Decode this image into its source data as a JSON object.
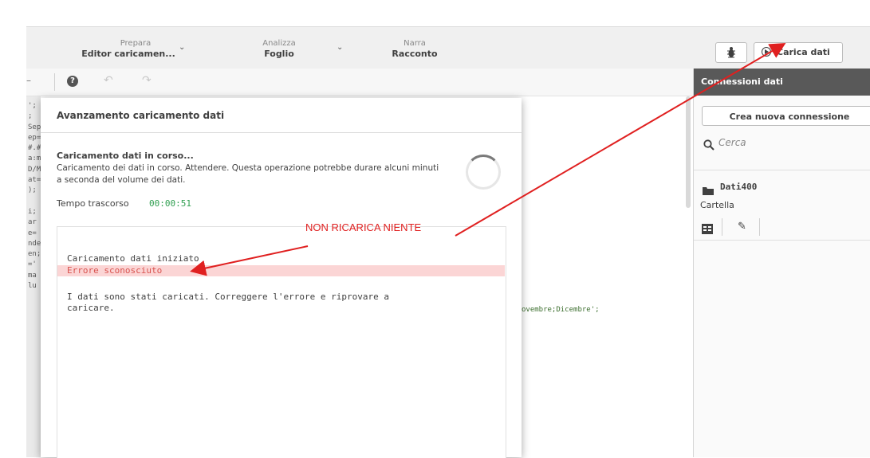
{
  "nav": {
    "prepare": {
      "label": "Prepara",
      "value": "Editor caricamen..."
    },
    "analyze": {
      "label": "Analizza",
      "value": "Foglio"
    },
    "narrate": {
      "label": "Narra",
      "value": "Racconto"
    }
  },
  "toolbar": {
    "help": "?",
    "load_button": "Carica dati"
  },
  "connections": {
    "header": "Connessioni dati",
    "new_button": "Crea nuova connessione",
    "search_placeholder": "Cerca",
    "item_name": "Dati400",
    "item_type": "Cartella"
  },
  "editor": {
    "left_fragments": [
      "';",
      ";",
      "Sep",
      "ep=",
      "#.#",
      "a:m",
      "D/M",
      "at=",
      ");",
      "",
      "i;",
      "ar",
      "e=",
      "nde",
      "en;",
      "='",
      "ma",
      "lu"
    ],
    "right_fragment": "ovembre;Dicembre';"
  },
  "dialog": {
    "title": "Avanzamento caricamento dati",
    "status_title": "Caricamento dati in corso...",
    "status_text": "Caricamento dei dati in corso. Attendere. Questa operazione potrebbe durare alcuni minuti a seconda del volume dei dati.",
    "elapsed_label": "Tempo trascorso",
    "elapsed_value": "00:00:51",
    "log": {
      "line1": "Caricamento dati iniziato",
      "error": "Errore sconosciuto",
      "line3": "I dati sono stati caricati. Correggere l'errore e riprovare a",
      "line4": "caricare."
    }
  },
  "annotation": {
    "text": "NON RICARICA NIENTE",
    "color": "#e02020"
  },
  "colors": {
    "accent": "#e0a24b",
    "elapsed": "#2e9e4f",
    "error_bg": "#fbd5d5",
    "panel_header": "#595959"
  }
}
